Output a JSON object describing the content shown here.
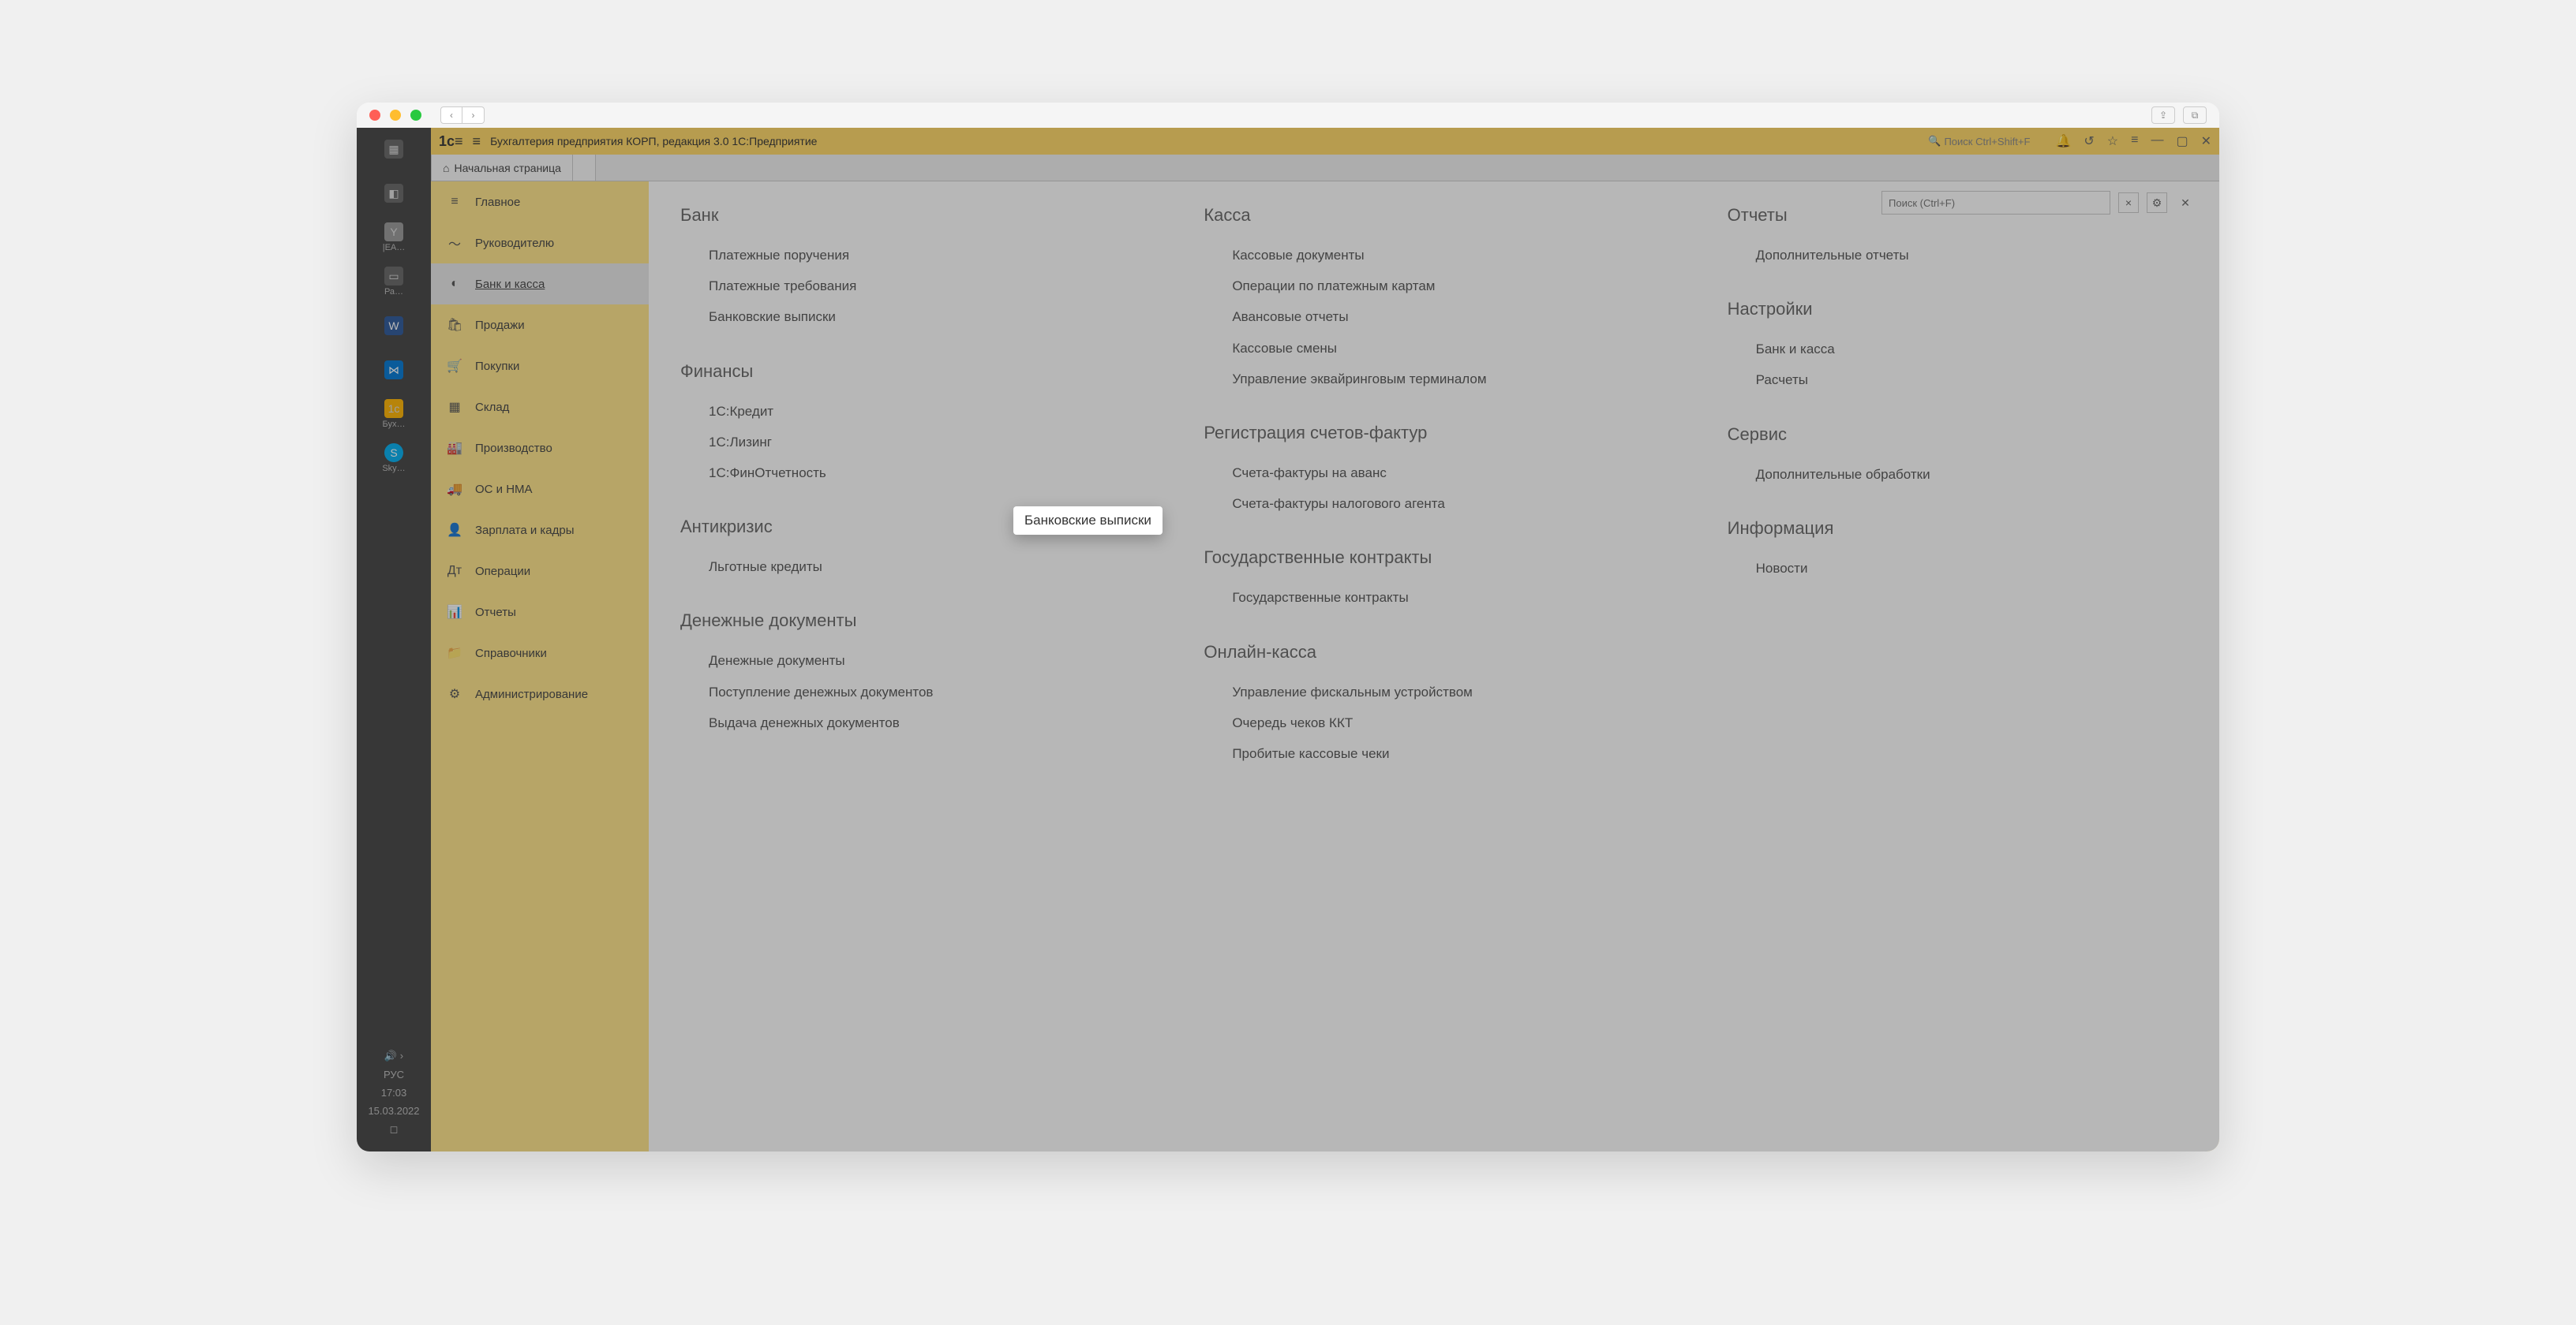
{
  "app_title": "Бухгалтерия предприятия КОРП, редакция 3.0 1С:Предприятие",
  "search_placeholder": "Поиск Ctrl+Shift+F",
  "home_tab": "Начальная страница",
  "panel_search": "Поиск (Ctrl+F)",
  "highlight_text": "Банковские выписки",
  "os_taskbar": {
    "items": [
      {
        "label": ""
      },
      {
        "label": ""
      },
      {
        "label": "|EA…"
      },
      {
        "label": "Ра…"
      },
      {
        "label": ""
      },
      {
        "label": ""
      },
      {
        "label": "Бух…"
      },
      {
        "label": "Sky…"
      }
    ],
    "lang": "РУС",
    "time": "17:03",
    "date": "15.03.2022"
  },
  "nav": [
    {
      "icon": "≡",
      "label": "Главное"
    },
    {
      "icon": "〜",
      "label": "Руководителю"
    },
    {
      "icon": "◐",
      "label": "Банк и касса",
      "selected": true
    },
    {
      "icon": "🛍",
      "label": "Продажи"
    },
    {
      "icon": "🛒",
      "label": "Покупки"
    },
    {
      "icon": "▦",
      "label": "Склад"
    },
    {
      "icon": "🏭",
      "label": "Производство"
    },
    {
      "icon": "🚚",
      "label": "ОС и НМА"
    },
    {
      "icon": "👤",
      "label": "Зарплата и кадры"
    },
    {
      "icon": "Дт",
      "label": "Операции"
    },
    {
      "icon": "📊",
      "label": "Отчеты"
    },
    {
      "icon": "📁",
      "label": "Справочники"
    },
    {
      "icon": "⚙",
      "label": "Администрирование"
    }
  ],
  "columns": [
    {
      "sections": [
        {
          "title": "Банк",
          "items": [
            "Платежные поручения",
            "Платежные требования",
            "Банковские выписки"
          ]
        },
        {
          "title": "Финансы",
          "items": [
            "1С:Кредит",
            "1С:Лизинг",
            "1С:ФинОтчетность"
          ]
        },
        {
          "title": "Антикризис",
          "items": [
            "Льготные кредиты"
          ]
        },
        {
          "title": "Денежные документы",
          "items": [
            "Денежные документы",
            "Поступление денежных документов",
            "Выдача денежных документов"
          ]
        }
      ]
    },
    {
      "sections": [
        {
          "title": "Касса",
          "items": [
            "Кассовые документы",
            "Операции по платежным картам",
            "Авансовые отчеты",
            "Кассовые смены",
            "Управление эквайринговым терминалом"
          ]
        },
        {
          "title": "Регистрация счетов-фактур",
          "items": [
            "Счета-фактуры на аванс",
            "Счета-фактуры налогового агента"
          ]
        },
        {
          "title": "Государственные контракты",
          "items": [
            "Государственные контракты"
          ]
        },
        {
          "title": "Онлайн-касса",
          "items": [
            "Управление фискальным устройством",
            "Очередь чеков ККТ",
            "Пробитые кассовые чеки"
          ]
        }
      ]
    },
    {
      "sections": [
        {
          "title": "Отчеты",
          "items": [
            "Дополнительные отчеты"
          ]
        },
        {
          "title": "Настройки",
          "items": [
            "Банк и касса",
            "Расчеты"
          ]
        },
        {
          "title": "Сервис",
          "items": [
            "Дополнительные обработки"
          ]
        },
        {
          "title": "Информация",
          "items": [
            "Новости"
          ]
        }
      ]
    }
  ]
}
